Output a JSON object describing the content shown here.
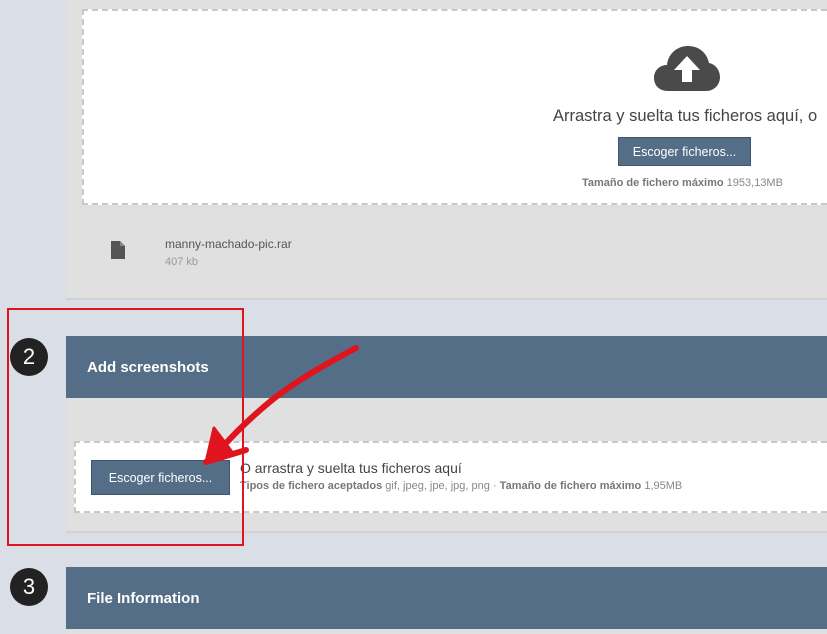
{
  "section1": {
    "drop_text": "Arrastra y suelta tus ficheros aquí, o",
    "choose_button": "Escoger ficheros...",
    "max_size_label": "Tamaño de fichero máximo",
    "max_size_value": "1953,13MB",
    "file": {
      "name": "manny-machado-pic.rar",
      "size": "407 kb"
    }
  },
  "step2": {
    "number": "2",
    "title": "Add screenshots",
    "choose_button": "Escoger ficheros...",
    "drop_text": "O arrastra y suelta tus ficheros aquí",
    "accepted_label": "Tipos de fichero aceptados",
    "accepted_types": "gif, jpeg, jpe, jpg, png",
    "separator": "·",
    "max_size_label": "Tamaño de fichero máximo",
    "max_size_value": "1,95MB"
  },
  "step3": {
    "number": "3",
    "title": "File Information"
  },
  "colors": {
    "header": "#546e87",
    "button": "#546e87",
    "annotation": "#e0141e",
    "page_bg": "#d9dee7"
  }
}
